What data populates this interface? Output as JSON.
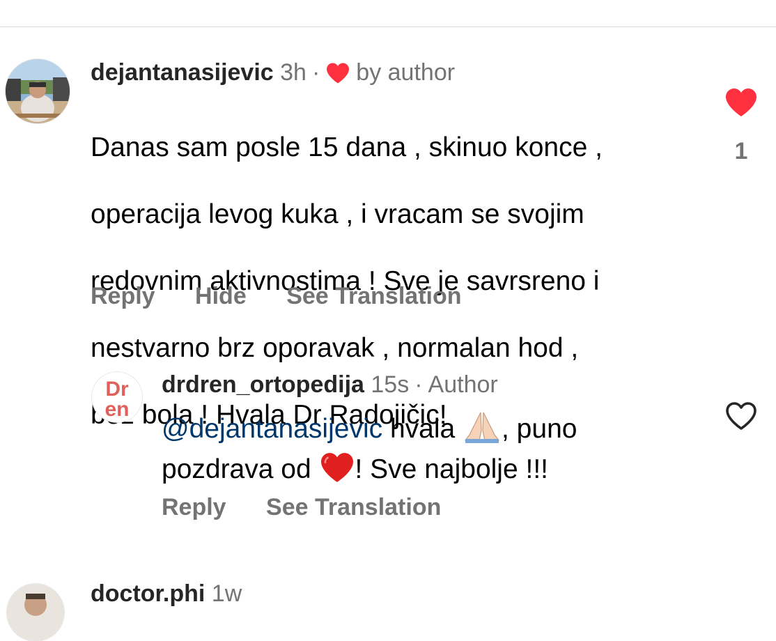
{
  "comments": [
    {
      "username": "dejantanasijevic",
      "time": "3h",
      "separator": "·",
      "liked_by": "by author",
      "lines": [
        "Danas sam posle 15 dana , skinuo konce ,",
        "operacija levog kuka , i vracam se svojim",
        "redovnim aktivnostima ! Sve je savrsreno i",
        "nestvarno brz oporavak , normalan hod ,",
        "bez bola ! Hvala Dr Radojičic!"
      ],
      "actions": {
        "reply": "Reply",
        "hide": "Hide",
        "translate": "See Translation"
      },
      "like_count": "1",
      "liked": true,
      "accent": "#ff3040"
    },
    {
      "username": "drdren_ortopedija",
      "time": "15s",
      "separator": "·",
      "role": "Author",
      "mention": "@dejantanasijevic",
      "line1_a": " hvala ",
      "line1_b": ", puno",
      "line2_a": "pozdrava od ",
      "line2_b": "! Sve najbolje !!!",
      "avatar_text_top": "Dr",
      "avatar_text_bottom": "en",
      "actions": {
        "reply": "Reply",
        "translate": "See Translation"
      },
      "liked": false,
      "mention_color": "#00376b"
    },
    {
      "username": "doctor.phi",
      "time": "1w"
    }
  ],
  "icons": {
    "heart_filled": "heart-filled-icon",
    "heart_outline": "heart-outline-icon",
    "pray": "folded-hands-emoji",
    "red_heart": "red-heart-emoji"
  }
}
